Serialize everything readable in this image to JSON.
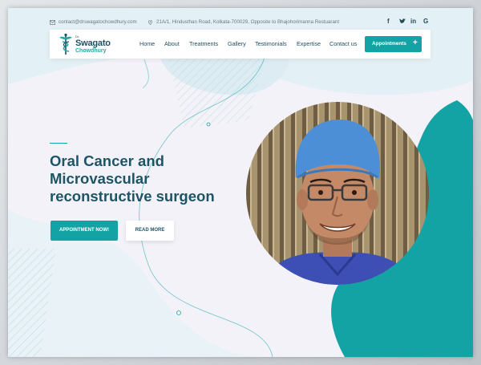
{
  "topbar": {
    "email": "contact@drswagatochowdhury.com",
    "address": "21A/1, Hindusthan Road, Kolkata-700029, Opposite to Bhajohorimanna Restuarant",
    "social": [
      "f",
      "⚑",
      "in",
      "G"
    ]
  },
  "logo": {
    "prefix": "Dr.",
    "name": "Swagato",
    "surname": "Chowdhury"
  },
  "nav": {
    "items": [
      "Home",
      "About",
      "Treatments",
      "Gallery",
      "Testimonials",
      "Expertise",
      "Contact us"
    ],
    "cta_label": "Appointments",
    "cta_icon": "+"
  },
  "hero": {
    "title_line1": "Oral Cancer and",
    "title_line2": "Microvascular",
    "title_line3": "reconstructive surgeon",
    "primary_button": "APPOINTMENT NOW!",
    "secondary_button": "READ MORE"
  },
  "colors": {
    "teal": "#14a3a5",
    "navy": "#1e5566",
    "bg_light": "#e3f0f5",
    "bg_blob": "#f6f3fa"
  }
}
